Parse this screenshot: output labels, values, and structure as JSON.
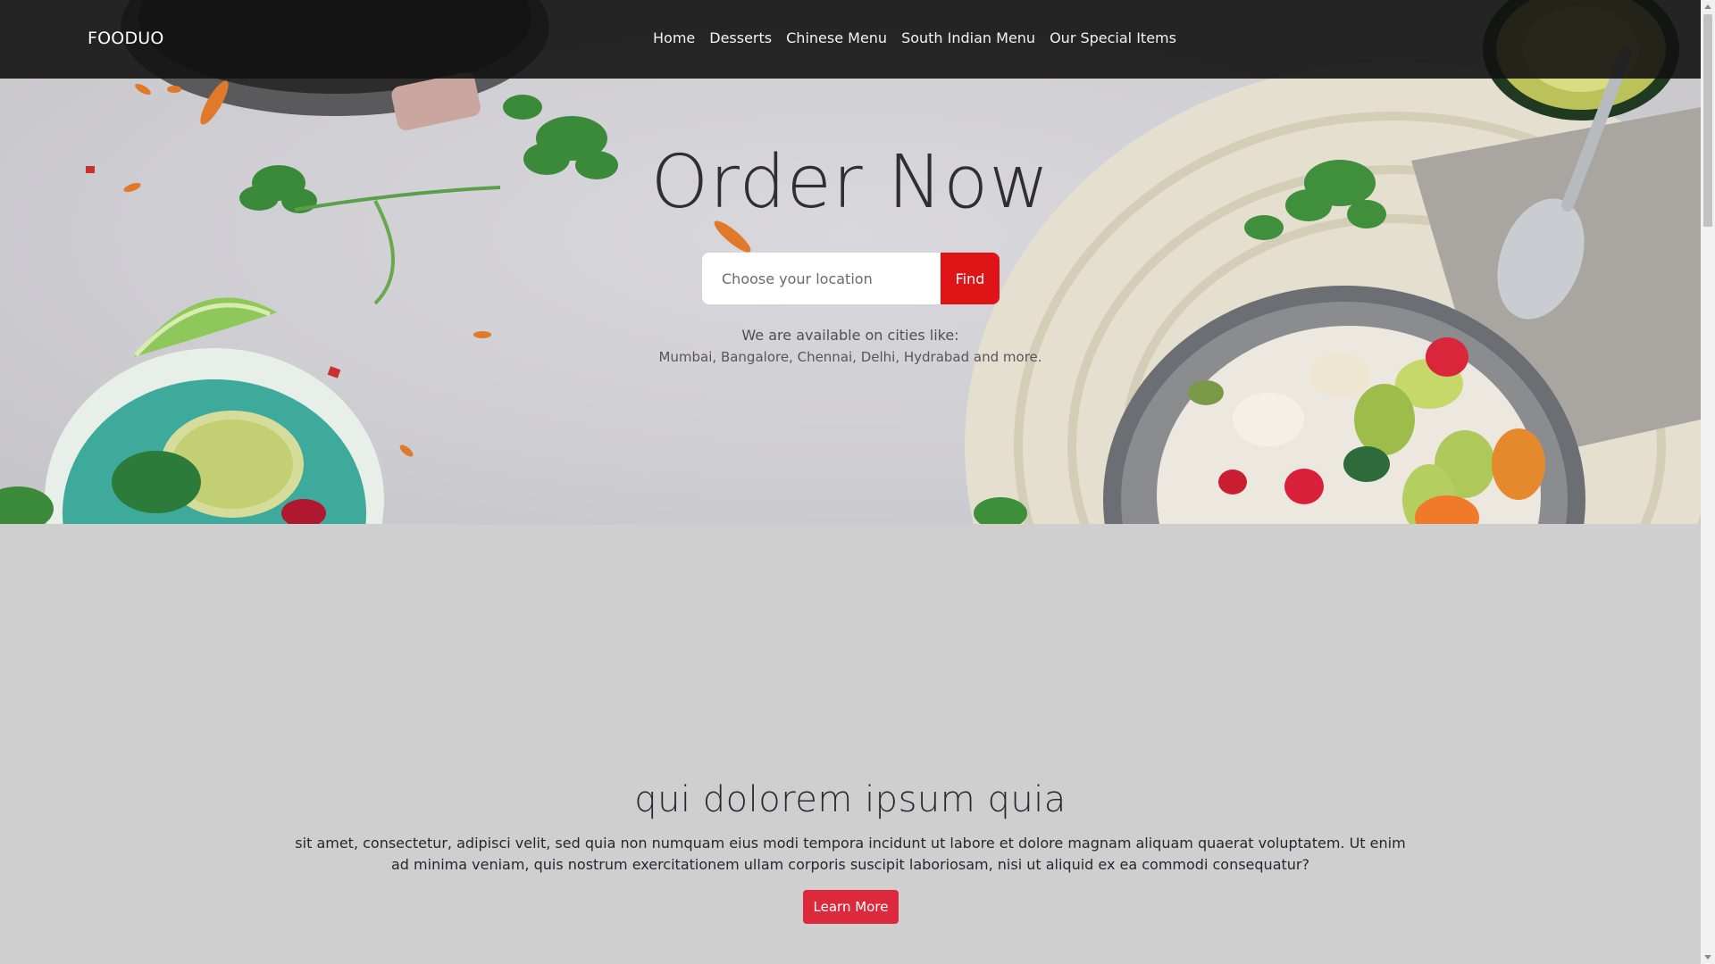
{
  "navbar": {
    "brand": "FOODUO",
    "links": [
      {
        "label": "Home"
      },
      {
        "label": "Desserts"
      },
      {
        "label": "Chinese Menu"
      },
      {
        "label": "South Indian Menu"
      },
      {
        "label": "Our Special Items"
      }
    ]
  },
  "hero": {
    "title": "Order Now",
    "search": {
      "placeholder": "Choose your location",
      "value": "",
      "button_label": "Find"
    },
    "availability_line1": "We are available on cities like:",
    "availability_line2": "Mumbai, Bangalore, Chennai, Delhi, Hydrabad and more."
  },
  "section": {
    "title": "qui dolorem ipsum quia",
    "text": "sit amet, consectetur, adipisci velit, sed quia non numquam eius modi tempora incidunt ut labore et dolore magnam aliquam quaerat voluptatem. Ut enim ad minima veniam, quis nostrum exercitationem ullam corporis suscipit laboriosam, nisi ut aliquid ex ea commodi consequatur?",
    "button_label": "Learn More"
  },
  "colors": {
    "navbar_bg": "#121212",
    "accent_red": "#e01416",
    "learn_more_bg": "#dc2a3c",
    "section_bg": "#d0cfd0"
  },
  "icons": [
    "scroll-up-arrow-icon",
    "scroll-down-arrow-icon"
  ]
}
